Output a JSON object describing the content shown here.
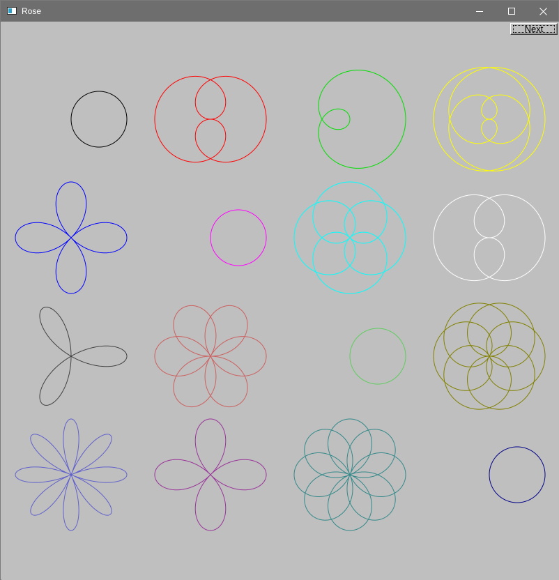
{
  "window": {
    "title": "Rose",
    "title_bar_color": "#6e6e6e",
    "background_color": "#bfbfbf"
  },
  "title_controls": [
    {
      "name": "minimize",
      "icon": "minimize-icon"
    },
    {
      "name": "maximize",
      "icon": "maximize-icon"
    },
    {
      "name": "close",
      "icon": "close-icon"
    }
  ],
  "toolbar": {
    "next_label": "Next"
  },
  "roses": [
    {
      "n": 1,
      "d": 1,
      "color": "#000000"
    },
    {
      "n": 1,
      "d": 2,
      "color": "#ff0000"
    },
    {
      "n": 1,
      "d": 3,
      "color": "#00dd00"
    },
    {
      "n": 1,
      "d": 4,
      "color": "#ffff00"
    },
    {
      "n": 2,
      "d": 1,
      "color": "#0000ff"
    },
    {
      "n": 2,
      "d": 2,
      "color": "#ff00ff"
    },
    {
      "n": 2,
      "d": 3,
      "color": "#00ffff"
    },
    {
      "n": 2,
      "d": 4,
      "color": "#ffffff"
    },
    {
      "n": 3,
      "d": 1,
      "color": "#404040"
    },
    {
      "n": 3,
      "d": 2,
      "color": "#cc5f5f"
    },
    {
      "n": 3,
      "d": 3,
      "color": "#5fcc5f"
    },
    {
      "n": 3,
      "d": 4,
      "color": "#808000"
    },
    {
      "n": 4,
      "d": 1,
      "color": "#6060cc"
    },
    {
      "n": 4,
      "d": 2,
      "color": "#993399"
    },
    {
      "n": 4,
      "d": 3,
      "color": "#338888"
    },
    {
      "n": 4,
      "d": 4,
      "color": "#000088"
    }
  ]
}
